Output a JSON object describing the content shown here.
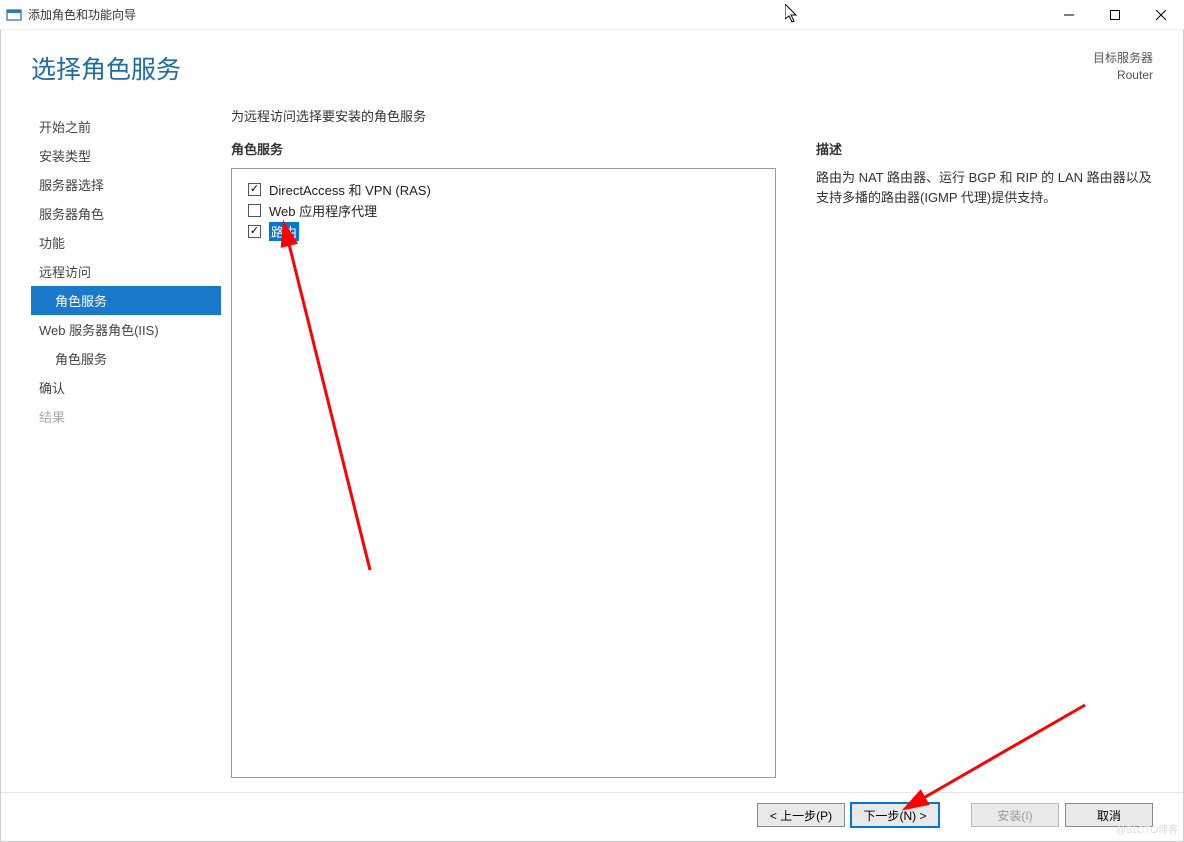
{
  "window": {
    "title": "添加角色和功能向导"
  },
  "header": {
    "page_title": "选择角色服务",
    "target_label": "目标服务器",
    "target_name": "Router"
  },
  "sidebar": {
    "items": [
      {
        "label": "开始之前",
        "indent": false,
        "active": false,
        "disabled": false
      },
      {
        "label": "安装类型",
        "indent": false,
        "active": false,
        "disabled": false
      },
      {
        "label": "服务器选择",
        "indent": false,
        "active": false,
        "disabled": false
      },
      {
        "label": "服务器角色",
        "indent": false,
        "active": false,
        "disabled": false
      },
      {
        "label": "功能",
        "indent": false,
        "active": false,
        "disabled": false
      },
      {
        "label": "远程访问",
        "indent": false,
        "active": false,
        "disabled": false
      },
      {
        "label": "角色服务",
        "indent": true,
        "active": true,
        "disabled": false
      },
      {
        "label": "Web 服务器角色(IIS)",
        "indent": false,
        "active": false,
        "disabled": false
      },
      {
        "label": "角色服务",
        "indent": true,
        "active": false,
        "disabled": false
      },
      {
        "label": "确认",
        "indent": false,
        "active": false,
        "disabled": false
      },
      {
        "label": "结果",
        "indent": false,
        "active": false,
        "disabled": true
      }
    ]
  },
  "main": {
    "instruction": "为远程访问选择要安装的角色服务",
    "roles_title": "角色服务",
    "roles": [
      {
        "label": "DirectAccess 和 VPN (RAS)",
        "checked": true,
        "highlighted": false
      },
      {
        "label": "Web 应用程序代理",
        "checked": false,
        "highlighted": false
      },
      {
        "label": "路由",
        "checked": true,
        "highlighted": true
      }
    ],
    "description_title": "描述",
    "description_text": "路由为 NAT 路由器、运行 BGP 和 RIP 的 LAN 路由器以及支持多播的路由器(IGMP 代理)提供支持。"
  },
  "footer": {
    "prev": "< 上一步(P)",
    "next": "下一步(N) >",
    "install": "安装(I)",
    "cancel": "取消"
  }
}
